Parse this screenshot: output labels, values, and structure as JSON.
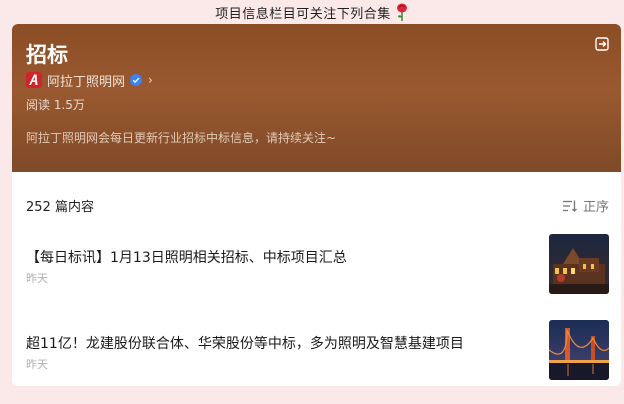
{
  "banner": {
    "text": "项目信息栏目可关注下列合集",
    "icon": "rose-icon"
  },
  "header": {
    "title": "招标",
    "author": "阿拉丁照明网",
    "reads": "阅读 1.5万",
    "description": "阿拉丁照明网会每日更新行业招标中标信息，请持续关注~",
    "colors": {
      "header_bg": "#8b4d25",
      "verified": "#3b82f6",
      "logo": "#d0242b"
    }
  },
  "list": {
    "count": "252 篇内容",
    "sort_label": "正序",
    "articles": [
      {
        "title": "【每日标讯】1月13日照明相关招标、中标项目汇总",
        "date": "昨天",
        "thumb": "night-building-image"
      },
      {
        "title": "超11亿！龙建股份联合体、华荣股份等中标，多为照明及智慧基建项目",
        "date": "昨天",
        "thumb": "lit-bridge-image"
      }
    ]
  }
}
